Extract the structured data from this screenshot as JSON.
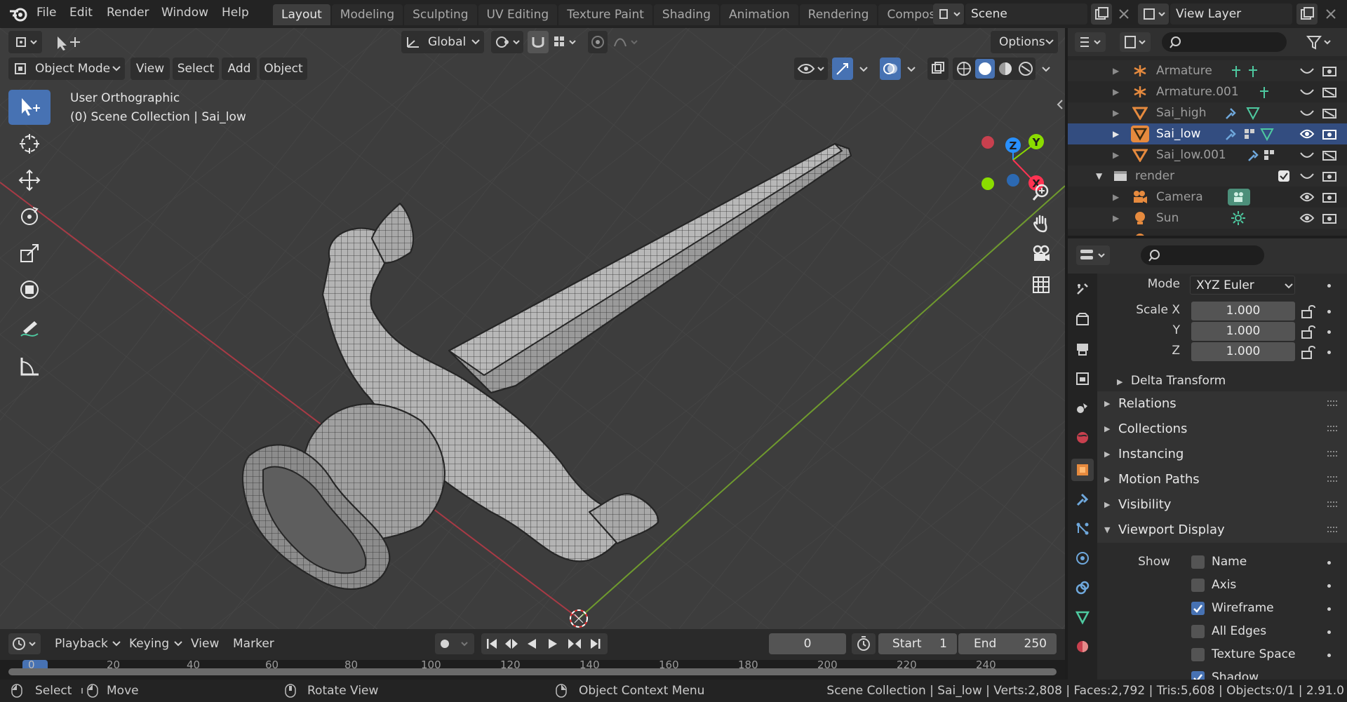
{
  "topbar": {
    "menus": [
      "File",
      "Edit",
      "Render",
      "Window",
      "Help"
    ],
    "workspaces": [
      "Layout",
      "Modeling",
      "Sculpting",
      "UV Editing",
      "Texture Paint",
      "Shading",
      "Animation",
      "Rendering",
      "Compos"
    ],
    "scene": "Scene",
    "view_layer": "View Layer"
  },
  "viewport_header": {
    "mode": "Object Mode",
    "menus": [
      "View",
      "Select",
      "Add",
      "Object"
    ],
    "orientation": "Global",
    "options": "Options"
  },
  "viewport": {
    "view_name": "User Orthographic",
    "collection_info": "(0) Scene Collection | Sai_low",
    "gizmo_axes": {
      "z": "Z",
      "y": "Y",
      "x": "X"
    }
  },
  "outliner": {
    "rows": [
      {
        "name": "Armature",
        "active": false
      },
      {
        "name": "Armature.001",
        "active": false
      },
      {
        "name": "Sai_high",
        "active": false
      },
      {
        "name": "Sai_low",
        "active": true
      },
      {
        "name": "Sai_low.001",
        "active": false
      },
      {
        "name": "render",
        "active": false
      },
      {
        "name": "Camera",
        "active": false
      },
      {
        "name": "Sun",
        "active": false
      }
    ]
  },
  "properties": {
    "mode_label": "Mode",
    "mode_value": "XYZ Euler",
    "scale": [
      {
        "label": "Scale X",
        "value": "1.000"
      },
      {
        "label": "Y",
        "value": "1.000"
      },
      {
        "label": "Z",
        "value": "1.000"
      }
    ],
    "delta_transform": "Delta Transform",
    "panels": [
      "Relations",
      "Collections",
      "Instancing",
      "Motion Paths",
      "Visibility",
      "Viewport Display"
    ],
    "show_label": "Show",
    "show_options": [
      {
        "label": "Name",
        "checked": false
      },
      {
        "label": "Axis",
        "checked": false
      },
      {
        "label": "Wireframe",
        "checked": true
      },
      {
        "label": "All Edges",
        "checked": false
      },
      {
        "label": "Texture Space",
        "checked": false
      },
      {
        "label": "Shadow",
        "checked": true
      }
    ]
  },
  "timeline": {
    "menus": [
      "Playback",
      "Keying",
      "View",
      "Marker"
    ],
    "current_frame": "0",
    "start_label": "Start",
    "start_value": "1",
    "end_label": "End",
    "end_value": "250",
    "ruler_ticks": [
      "0",
      "20",
      "40",
      "60",
      "80",
      "100",
      "120",
      "140",
      "160",
      "180",
      "200",
      "220",
      "240"
    ]
  },
  "statusbar": {
    "select": "Select",
    "move": "Move",
    "rotate": "Rotate View",
    "context": "Object Context Menu",
    "stats": "Scene Collection | Sai_low | Verts:2,808 | Faces:2,792 | Tris:5,608 | Objects:0/1 | 2.91.0"
  },
  "colors": {
    "accent": "#4772b3",
    "x_axis": "#ff3352",
    "y_axis": "#8bdc00",
    "z_axis": "#2890ff",
    "object_orange": "#e68a3e"
  }
}
